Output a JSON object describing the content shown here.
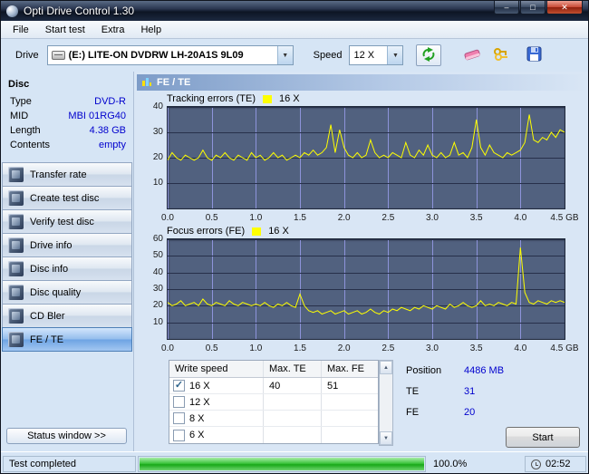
{
  "window": {
    "title": "Opti Drive Control 1.30"
  },
  "icons": {
    "minimize": "–",
    "maximize": "□",
    "close": "✕",
    "dropdown": "▼",
    "scroll_up": "▲",
    "scroll_down": "▼"
  },
  "menu": {
    "items": [
      "File",
      "Start test",
      "Extra",
      "Help"
    ]
  },
  "toolbar": {
    "drive_label": "Drive",
    "drive_value": "(E:) LITE-ON DVDRW LH-20A1S 9L09",
    "speed_label": "Speed",
    "speed_value": "12 X"
  },
  "sidebar": {
    "title": "Disc",
    "info": [
      {
        "label": "Type",
        "value": "DVD-R"
      },
      {
        "label": "MID",
        "value": "MBI 01RG40"
      },
      {
        "label": "Length",
        "value": "4.38 GB"
      },
      {
        "label": "Contents",
        "value": "empty"
      }
    ],
    "buttons": [
      {
        "label": "Transfer rate"
      },
      {
        "label": "Create test disc"
      },
      {
        "label": "Verify test disc"
      },
      {
        "label": "Drive info"
      },
      {
        "label": "Disc info"
      },
      {
        "label": "Disc quality"
      },
      {
        "label": "CD Bler"
      },
      {
        "label": "FE / TE"
      }
    ],
    "status_button": "Status window >>"
  },
  "main": {
    "header": "FE / TE"
  },
  "write_table": {
    "headers": [
      "Write speed",
      "Max. TE",
      "Max. FE"
    ],
    "rows": [
      {
        "speed": "16 X",
        "check": "✓",
        "max_te": "40",
        "max_fe": "51"
      },
      {
        "speed": "12 X",
        "check": "",
        "max_te": "",
        "max_fe": ""
      },
      {
        "speed": "8 X",
        "check": "",
        "max_te": "",
        "max_fe": ""
      },
      {
        "speed": "6 X",
        "check": "",
        "max_te": "",
        "max_fe": ""
      }
    ]
  },
  "results": {
    "position_label": "Position",
    "position_value": "4486 MB",
    "te_label": "TE",
    "te_value": "31",
    "fe_label": "FE",
    "fe_value": "20",
    "start_label": "Start"
  },
  "statusbar": {
    "status": "Test completed",
    "progress_label": "100.0%",
    "time": "02:52"
  },
  "colors": {
    "trace": "#ffff00",
    "plot_bg": "#51617f",
    "grid_v": "#8d93da",
    "grid_h": "#27304a",
    "value_text": "#0000cd",
    "progress_green": "#22b14c"
  },
  "chart_data": [
    {
      "type": "line",
      "title": "Tracking errors (TE)",
      "legend": "16 X",
      "ylim": [
        0,
        40
      ],
      "yticks": [
        10,
        20,
        30,
        40
      ],
      "xlim": [
        0,
        4.5
      ],
      "xticks": [
        {
          "v": 0,
          "label": "0.0"
        },
        {
          "v": 0.5,
          "label": "0.5"
        },
        {
          "v": 1,
          "label": "1.0"
        },
        {
          "v": 1.5,
          "label": "1.5"
        },
        {
          "v": 2,
          "label": "2.0"
        },
        {
          "v": 2.5,
          "label": "2.5"
        },
        {
          "v": 3,
          "label": "3.0"
        },
        {
          "v": 3.5,
          "label": "3.5"
        },
        {
          "v": 4,
          "label": "4.0"
        },
        {
          "v": 4.5,
          "label": "4.5 GB"
        }
      ],
      "values": [
        19,
        22,
        20,
        19,
        21,
        20,
        19,
        20,
        23,
        20,
        19,
        21,
        20,
        22,
        20,
        19,
        21,
        20,
        19,
        22,
        20,
        21,
        19,
        20,
        22,
        20,
        21,
        19,
        20,
        21,
        20,
        22,
        21,
        23,
        21,
        22,
        24,
        33,
        22,
        31,
        24,
        21,
        20,
        22,
        20,
        21,
        27,
        22,
        20,
        21,
        20,
        22,
        21,
        20,
        26,
        21,
        20,
        23,
        21,
        25,
        21,
        20,
        22,
        20,
        21,
        26,
        21,
        22,
        20,
        24,
        35,
        24,
        21,
        25,
        22,
        21,
        20,
        22,
        21,
        22,
        23,
        26,
        37,
        27,
        26,
        28,
        27,
        30,
        28,
        31,
        30
      ]
    },
    {
      "type": "line",
      "title": "Focus errors (FE)",
      "legend": "16 X",
      "ylim": [
        0,
        60
      ],
      "yticks": [
        10,
        20,
        30,
        40,
        50,
        60
      ],
      "xlim": [
        0,
        4.5
      ],
      "xticks": [
        {
          "v": 0,
          "label": "0.0"
        },
        {
          "v": 0.5,
          "label": "0.5"
        },
        {
          "v": 1,
          "label": "1.0"
        },
        {
          "v": 1.5,
          "label": "1.5"
        },
        {
          "v": 2,
          "label": "2.0"
        },
        {
          "v": 2.5,
          "label": "2.5"
        },
        {
          "v": 3,
          "label": "3.0"
        },
        {
          "v": 3.5,
          "label": "3.5"
        },
        {
          "v": 4,
          "label": "4.0"
        },
        {
          "v": 4.5,
          "label": "4.5 GB"
        }
      ],
      "values": [
        22,
        20,
        21,
        23,
        20,
        21,
        22,
        20,
        24,
        21,
        20,
        22,
        21,
        20,
        23,
        21,
        20,
        22,
        21,
        20,
        21,
        20,
        22,
        20,
        19,
        21,
        20,
        22,
        20,
        19,
        27,
        20,
        17,
        16,
        17,
        15,
        16,
        17,
        15,
        16,
        17,
        15,
        16,
        17,
        15,
        16,
        18,
        16,
        15,
        17,
        16,
        18,
        17,
        19,
        18,
        17,
        19,
        18,
        20,
        19,
        18,
        20,
        19,
        18,
        21,
        19,
        20,
        22,
        20,
        19,
        20,
        23,
        20,
        21,
        20,
        22,
        21,
        20,
        22,
        21,
        55,
        28,
        22,
        21,
        23,
        22,
        21,
        23,
        22,
        23,
        22
      ]
    }
  ]
}
